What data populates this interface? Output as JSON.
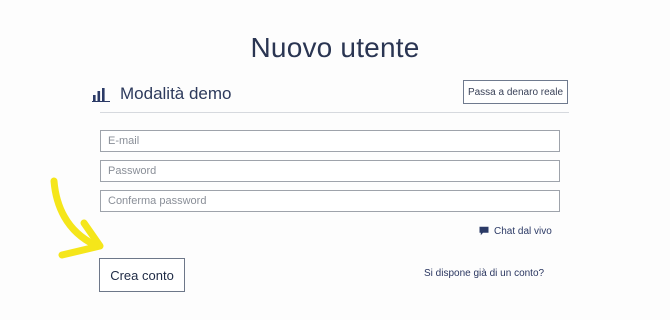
{
  "title": "Nuovo utente",
  "demo": {
    "label": "Modalità demo",
    "icon": "bar-chart-icon"
  },
  "real_money_button": "Passa a denaro reale",
  "form": {
    "email_placeholder": "E-mail",
    "password_placeholder": "Password",
    "confirm_placeholder": "Conferma password",
    "email_value": "",
    "password_value": "",
    "confirm_value": ""
  },
  "chat": {
    "label": "Chat dal vivo",
    "icon": "chat-bubble-icon"
  },
  "create_button": "Crea conto",
  "have_account_link": "Si dispone già di un conto?",
  "annotation": {
    "icon": "yellow-arrow-icon",
    "color": "#f5e61a"
  },
  "colors": {
    "text": "#2a3552",
    "border": "#9ea3ab",
    "button_border": "#6d7789"
  }
}
